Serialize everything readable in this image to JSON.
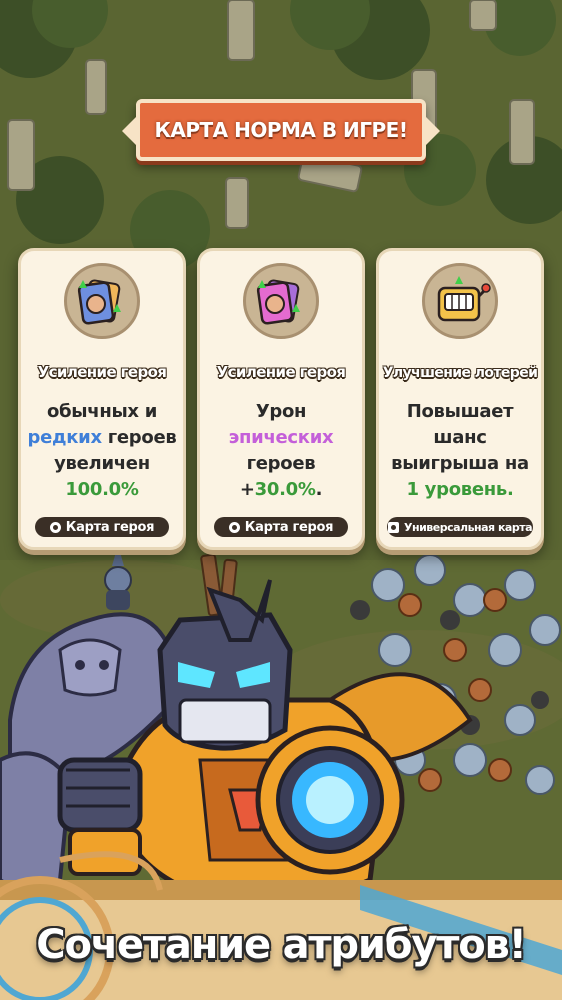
{
  "banner": {
    "title": "КАРТА НОРМА В ИГРЕ!"
  },
  "cards": [
    {
      "icon": "hero-card-blue-upgrade-icon",
      "title": "Усиление героя",
      "line1": "обычных и",
      "highlight": "редких",
      "line2_rest": " героев",
      "line3": "увеличен",
      "value": "100.0%",
      "footer": "Карта героя"
    },
    {
      "icon": "hero-card-pink-upgrade-icon",
      "title": "Усиление героя",
      "line1": "Урон",
      "highlight": "эпических",
      "line3": "героев",
      "value_prefix": "+",
      "value": "30.0%",
      "value_suffix": ".",
      "footer": "Карта героя"
    },
    {
      "icon": "lottery-machine-icon",
      "title": "Улучшение  лотерей",
      "line1": "Повышает",
      "line2": "шанс",
      "line3": "выигрыша на",
      "value": "1 уровень.",
      "footer": "Универсальная карта"
    }
  ],
  "slogan": "Сочетание атрибутов!",
  "colors": {
    "banner": "#e46b3e",
    "highlight_blue": "#3f7fd8",
    "highlight_purple": "#c45fd9",
    "value_green": "#3a9a3a",
    "card_bg": "#fbf3e3"
  }
}
